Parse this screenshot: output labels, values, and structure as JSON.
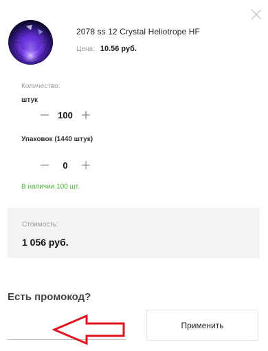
{
  "product": {
    "name": "2078 ss 12 Crystal Heliotrope HF",
    "price_label": "Цена:",
    "price_value": "10.56 руб."
  },
  "quantity": {
    "title": "Количество:",
    "unit_label": "штук",
    "unit_value": "100",
    "pack_label": "Упаковок (1440 штук)",
    "pack_value": "0"
  },
  "stock": "В наличии 100 шт.",
  "cost": {
    "label": "Стоимость:",
    "value": "1 056 руб."
  },
  "promo": {
    "title": "Есть промокод?",
    "input_value": "",
    "apply_label": "Применить"
  },
  "icons": {
    "close": "close-icon",
    "minus": "minus-icon",
    "plus": "plus-icon",
    "annotation": "red-arrow-left-icon"
  },
  "colors": {
    "stock_green": "#4caf3a",
    "cost_background": "#f3f3f3",
    "annotation_red": "#e0141e"
  }
}
